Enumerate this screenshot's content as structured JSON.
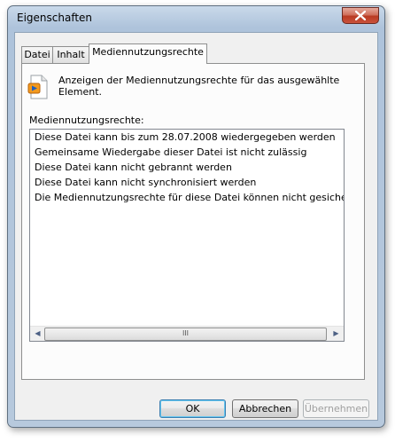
{
  "window": {
    "title": "Eigenschaften"
  },
  "tabs": [
    {
      "label": "Datei"
    },
    {
      "label": "Inhalt"
    },
    {
      "label": "Mediennutzungsrechte"
    }
  ],
  "panel": {
    "description": "Anzeigen der Mediennutzungsrechte für das ausgewählte Element.",
    "list_label": "Mediennutzungsrechte:",
    "items": [
      "Diese Datei kann bis zum 28.07.2008 wiedergegeben werden",
      "Gemeinsame Wiedergabe dieser Datei ist nicht zulässig",
      "Diese Datei kann nicht gebrannt werden",
      "Diese Datei kann nicht synchronisiert werden",
      "Die Mediennutzungsrechte für diese Datei können nicht gesichert werde"
    ],
    "scrollbar_grip": "III"
  },
  "buttons": {
    "ok": "OK",
    "cancel": "Abbrechen",
    "apply": "Übernehmen"
  },
  "icons": {
    "close": "close-icon",
    "media_file": "media-file-icon",
    "scroll_left": "arrow-left-icon",
    "scroll_right": "arrow-right-icon"
  }
}
